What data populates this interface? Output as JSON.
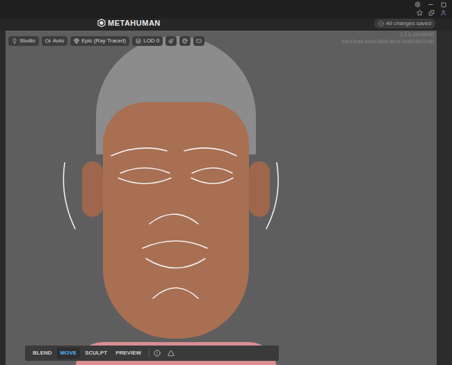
{
  "header": {
    "logo": "METAHUMAN",
    "status": "All changes saved"
  },
  "viewport_toolbar": [
    "Studio",
    "Auto",
    "Epic (Ray Traced)",
    "LOD 0"
  ],
  "build": {
    "version": "3.3.2-18246992",
    "id": "8a243ca4-6ea3-068d-8b2e-0cdb01b22c5b"
  },
  "modes": [
    {
      "label": "BLEND",
      "selected": false
    },
    {
      "label": "MOVE",
      "selected": true
    },
    {
      "label": "SCULPT",
      "selected": false
    },
    {
      "label": "PREVIEW",
      "selected": false
    }
  ]
}
